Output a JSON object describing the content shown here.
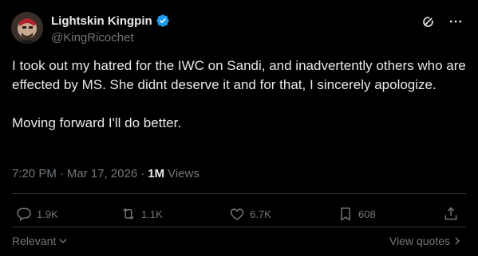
{
  "author": {
    "display_name": "Lightskin Kingpin",
    "handle": "@KingRicochet",
    "verified": true
  },
  "tweet": {
    "text": "I took out my hatred for the IWC on Sandi, and inadvertently others who are effected by MS. She didnt deserve it and for that, I sincerely apologize.\n\nMoving forward I'll do better.",
    "time": "7:20 PM",
    "date": "Mar 17, 2026",
    "separator": "·",
    "views_count": "1M",
    "views_label": "Views"
  },
  "actions": {
    "replies": "1.9K",
    "reposts": "1.1K",
    "likes": "6.7K",
    "bookmarks": "608"
  },
  "footer": {
    "sort_label": "Relevant",
    "view_quotes_label": "View quotes"
  },
  "colors": {
    "background": "#000000",
    "text": "#e7e9ea",
    "secondary": "#71767b",
    "verified": "#1d9bf0"
  }
}
